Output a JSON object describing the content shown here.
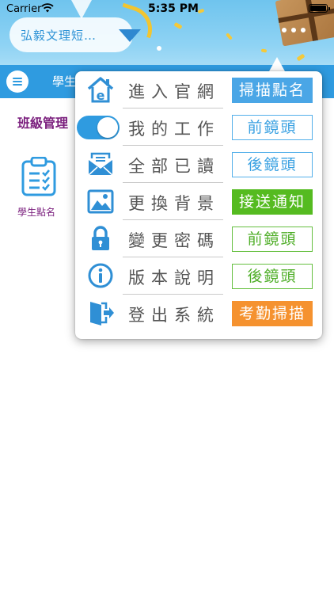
{
  "status_bar": {
    "carrier": "Carrier",
    "time": "5:35 PM"
  },
  "header": {
    "school_name": "弘毅文理短…"
  },
  "nav": {
    "tab_label": "學生"
  },
  "main": {
    "section_title": "班級管理",
    "features": [
      {
        "label": "學生點名",
        "icon": "clipboard-check-icon"
      }
    ]
  },
  "menu": {
    "items": [
      {
        "label": "進入官網",
        "icon": "website-home-icon",
        "badge": "掃描點名"
      },
      {
        "label": "我的工作",
        "icon": "toggle-switch",
        "badge": "前鏡頭"
      },
      {
        "label": "全部已讀",
        "icon": "envelope-icon",
        "badge": "後鏡頭"
      },
      {
        "label": "更換背景",
        "icon": "image-icon",
        "badge": "接送通知"
      },
      {
        "label": "變更密碼",
        "icon": "lock-icon",
        "badge": "前鏡頭"
      },
      {
        "label": "版本說明",
        "icon": "info-icon",
        "badge": "後鏡頭"
      },
      {
        "label": "登出系統",
        "icon": "logout-icon",
        "badge": "考勤掃描"
      }
    ]
  },
  "colors": {
    "primary_blue": "#2f9be0",
    "section_purple": "#7a1e7d",
    "badge_green": "#55bb20",
    "badge_orange": "#f5922f"
  }
}
